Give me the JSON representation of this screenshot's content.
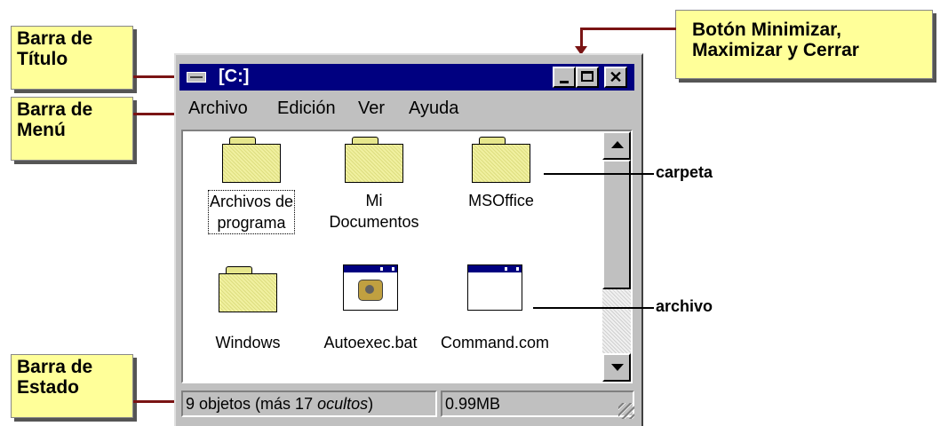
{
  "callouts": {
    "title_bar": {
      "line1": "Barra de",
      "line2": "Título"
    },
    "menu_bar": {
      "line1": "Barra de",
      "line2": "Menú"
    },
    "status_bar": {
      "line1": "Barra de",
      "line2": "Estado"
    },
    "buttons": {
      "line1": "Botón Minimizar,",
      "line2": "Maximizar y Cerrar"
    }
  },
  "labels": {
    "folder": "carpeta",
    "file": "archivo"
  },
  "window": {
    "title": "[C:]",
    "controls": {
      "minimize": "_",
      "maximize": "□",
      "close": "✕"
    },
    "menu": [
      "Archivo",
      "Edición",
      "Ver",
      "Ayuda"
    ],
    "items": [
      {
        "line1": "Archivos de",
        "line2": "programa",
        "icon": "folder-icon",
        "selected": true
      },
      {
        "line1": "Mi",
        "line2": "Documentos",
        "icon": "folder-icon"
      },
      {
        "line1": "MSOffice",
        "line2": "",
        "icon": "folder-icon"
      },
      {
        "line1": "Windows",
        "line2": "",
        "icon": "folder-icon"
      },
      {
        "line1": "Autoexec.bat",
        "line2": "",
        "icon": "batch-file-icon"
      },
      {
        "line1": "Command.com",
        "line2": "",
        "icon": "application-file-icon"
      }
    ],
    "status": {
      "objects_prefix": "9 objetos (más 17 ",
      "objects_hidden": "ocultos",
      "objects_suffix": ")",
      "size": "0.99MB"
    }
  },
  "colors": {
    "titlebar": "#000080",
    "callout_bg": "#ffff99",
    "connector": "#7a1414",
    "folder": "#e8e890"
  }
}
